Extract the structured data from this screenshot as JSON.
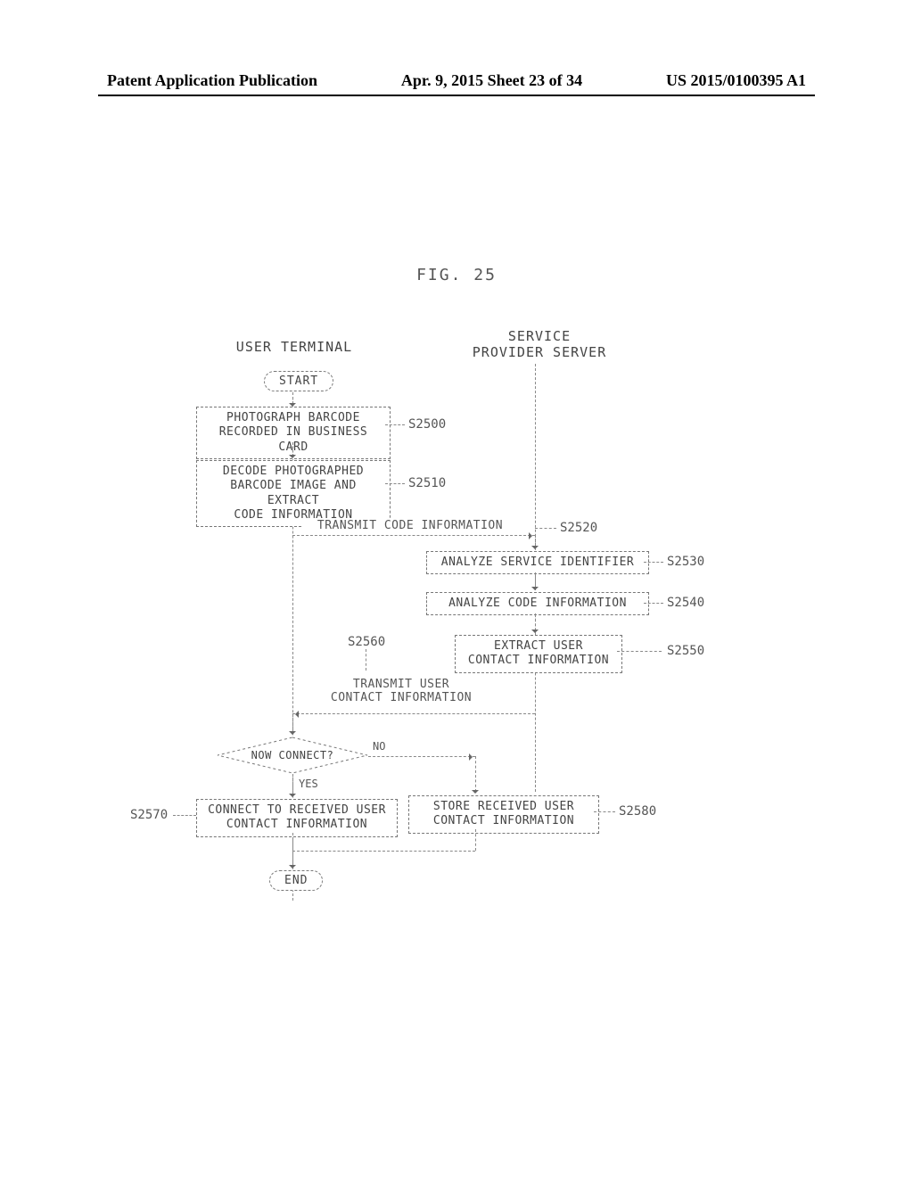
{
  "header": {
    "left": "Patent Application Publication",
    "center": "Apr. 9, 2015  Sheet 23 of 34",
    "right": "US 2015/0100395 A1"
  },
  "figure_label": "FIG. 25",
  "swimlanes": {
    "user": "USER TERMINAL",
    "server": "SERVICE\nPROVIDER SERVER"
  },
  "terminators": {
    "start": "START",
    "end": "END"
  },
  "steps": {
    "s2500": {
      "label": "S2500",
      "text": "PHOTOGRAPH BARCODE\nRECORDED IN BUSINESS CARD"
    },
    "s2510": {
      "label": "S2510",
      "text": "DECODE PHOTOGRAPHED\nBARCODE IMAGE AND EXTRACT\nCODE INFORMATION"
    },
    "s2520": {
      "label": "S2520",
      "text": "TRANSMIT CODE INFORMATION"
    },
    "s2530": {
      "label": "S2530",
      "text": "ANALYZE SERVICE IDENTIFIER"
    },
    "s2540": {
      "label": "S2540",
      "text": "ANALYZE CODE INFORMATION"
    },
    "s2550": {
      "label": "S2550",
      "text": "EXTRACT USER\nCONTACT INFORMATION"
    },
    "s2560": {
      "label": "S2560",
      "text": "TRANSMIT USER\nCONTACT INFORMATION"
    },
    "s2570": {
      "label": "S2570",
      "text": "CONNECT TO RECEIVED USER\nCONTACT INFORMATION"
    },
    "s2580": {
      "label": "S2580",
      "text": "STORE RECEIVED USER\nCONTACT INFORMATION"
    }
  },
  "decision": {
    "text": "NOW CONNECT?",
    "yes": "YES",
    "no": "NO"
  }
}
